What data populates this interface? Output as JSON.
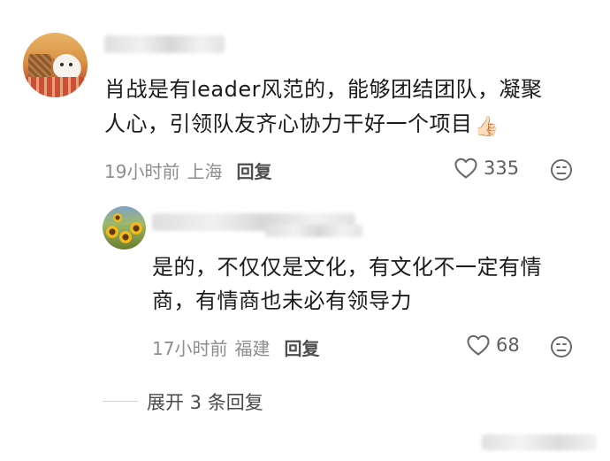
{
  "comment": {
    "text_line1": "肖战是有leader风范的，能够团结团队，凝聚",
    "text_line2": "人心，引领队友齐心协力干好一个项目",
    "emoji": "👍🏻",
    "time": "19小时前",
    "location": "上海",
    "reply_label": "回复",
    "likes": "335"
  },
  "reply": {
    "text_line1": "是的，不仅仅是文化，有文化不一定有情",
    "text_line2": "商，有情商也未必有领导力",
    "time": "17小时前",
    "location": "福建",
    "reply_label": "回复",
    "likes": "68"
  },
  "expand": {
    "label": "展开 3 条回复"
  },
  "colors": {
    "text": "#1b1b1b",
    "meta": "#8d8d8d",
    "reply_button": "#4e4e4e",
    "like_count": "#5f5f5f"
  },
  "icons": {
    "like": "heart-outline-icon",
    "dislike": "frown-face-icon",
    "emoji": "thumbs-up-emoji-icon"
  }
}
